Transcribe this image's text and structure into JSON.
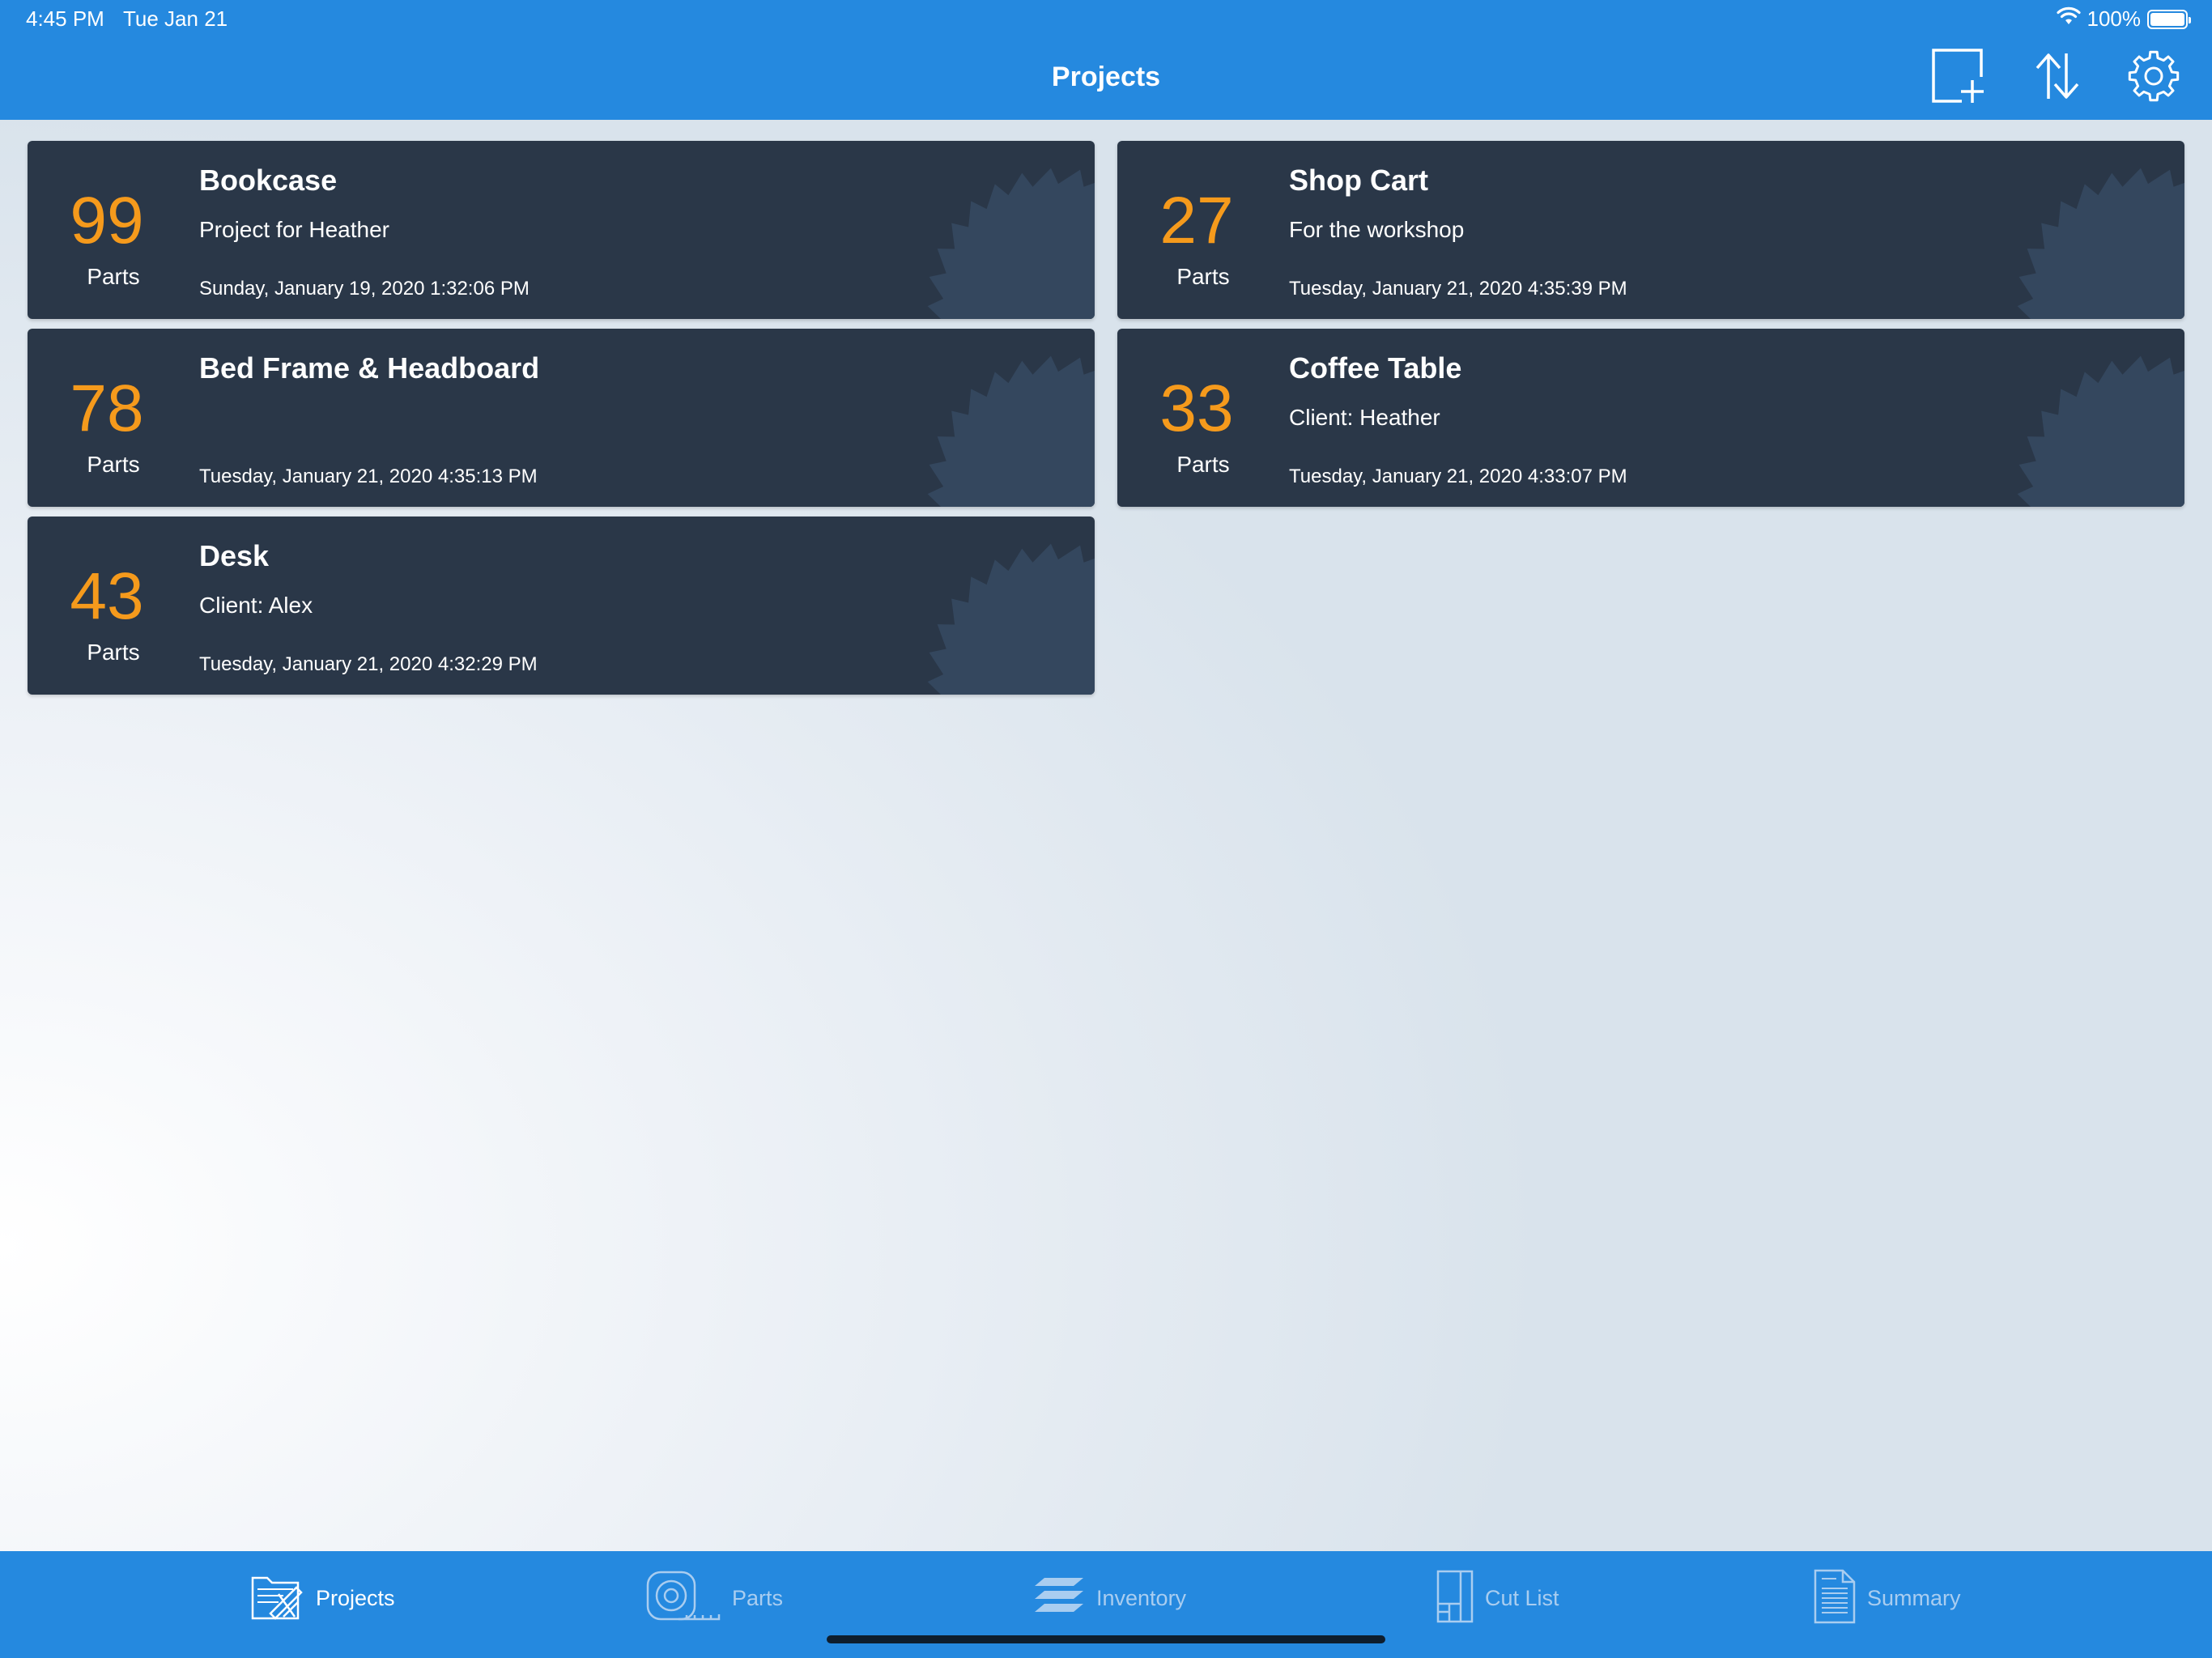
{
  "status_bar": {
    "time": "4:45 PM",
    "date": "Tue Jan 21",
    "battery": "100%"
  },
  "header": {
    "title": "Projects",
    "actions": [
      "new-project-icon",
      "sort-icon",
      "settings-icon"
    ]
  },
  "projects": [
    {
      "count": "99",
      "count_label": "Parts",
      "name": "Bookcase",
      "description": "Project for Heather",
      "date": "Sunday, January 19, 2020 1:32:06 PM"
    },
    {
      "count": "27",
      "count_label": "Parts",
      "name": "Shop Cart",
      "description": "For the workshop",
      "date": "Tuesday, January 21, 2020 4:35:39 PM"
    },
    {
      "count": "78",
      "count_label": "Parts",
      "name": "Bed Frame & Headboard",
      "description": "",
      "date": "Tuesday, January 21, 2020 4:35:13 PM"
    },
    {
      "count": "33",
      "count_label": "Parts",
      "name": "Coffee Table",
      "description": "Client: Heather",
      "date": "Tuesday, January 21, 2020 4:33:07 PM"
    },
    {
      "count": "43",
      "count_label": "Parts",
      "name": "Desk",
      "description": "Client: Alex",
      "date": "Tuesday, January 21, 2020 4:32:29 PM"
    }
  ],
  "tabs": [
    {
      "label": "Projects",
      "icon": "projects-icon",
      "active": true
    },
    {
      "label": "Parts",
      "icon": "tape-measure-icon",
      "active": false
    },
    {
      "label": "Inventory",
      "icon": "layers-icon",
      "active": false
    },
    {
      "label": "Cut List",
      "icon": "cut-list-icon",
      "active": false
    },
    {
      "label": "Summary",
      "icon": "summary-icon",
      "active": false
    }
  ],
  "colors": {
    "header": "#2589df",
    "card": "#2a3748",
    "accent": "#f59a1c",
    "tab_inactive": "#a9cdf0"
  }
}
